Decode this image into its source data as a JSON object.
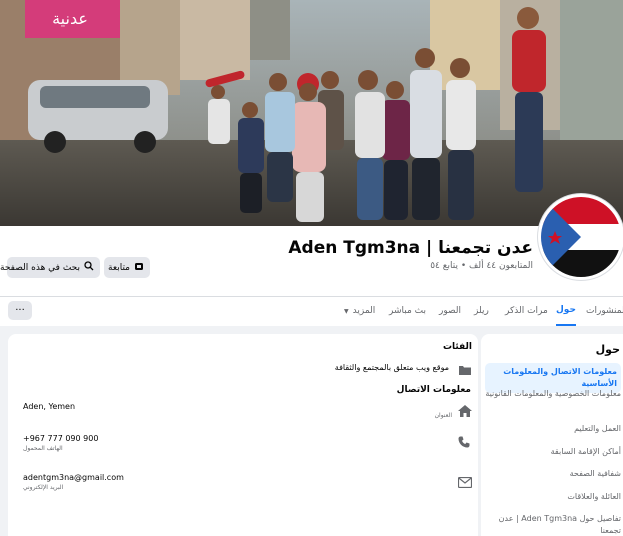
{
  "header": {
    "title": "عدن تجمعنا | Aden Tgm3na",
    "followers": "المتابعون ٤٤ ألف • يتابع ٥٤",
    "follow_label": "متابعة",
    "search_label": "بحث في هذه الصفحة"
  },
  "tabs": [
    {
      "label": "المنشورات"
    },
    {
      "label": "حول"
    },
    {
      "label": "مرات الذكر"
    },
    {
      "label": "ريلز"
    },
    {
      "label": "الصور"
    },
    {
      "label": "بث مباشر"
    },
    {
      "label": "المزيد"
    }
  ],
  "more_label": "···",
  "about": {
    "heading": "حول",
    "sidebar": [
      {
        "label": "معلومات الاتصال والمعلومات الأساسية"
      },
      {
        "label": "معلومات الخصوصية والمعلومات القانونية"
      },
      {
        "label": "العمل والتعليم"
      },
      {
        "label": "أماكن الإقامة السابقة"
      },
      {
        "label": "شفافية الصفحة"
      },
      {
        "label": "العائلة والعلاقات"
      },
      {
        "label": "تفاصيل حول Aden Tgm3na | عدن تجمعنا"
      }
    ]
  },
  "content": {
    "categories_title": "الفئات",
    "category_value": "موقع ويب متعلق بالمجتمع والثقافة",
    "contact_title": "معلومات الاتصال",
    "address_value": "Aden, Yemen",
    "address_label": "العنوان",
    "phone_value": "+967 777 090 900",
    "phone_label": "الهاتف المحمول",
    "email_value": "adentgm3na@gmail.com",
    "email_label": "البريد الإلكتروني"
  },
  "colors": {
    "accent": "#1877f2",
    "flag_red": "#ce1126",
    "flag_blue": "#2a5fb0",
    "flag_star": "#ce1126"
  }
}
